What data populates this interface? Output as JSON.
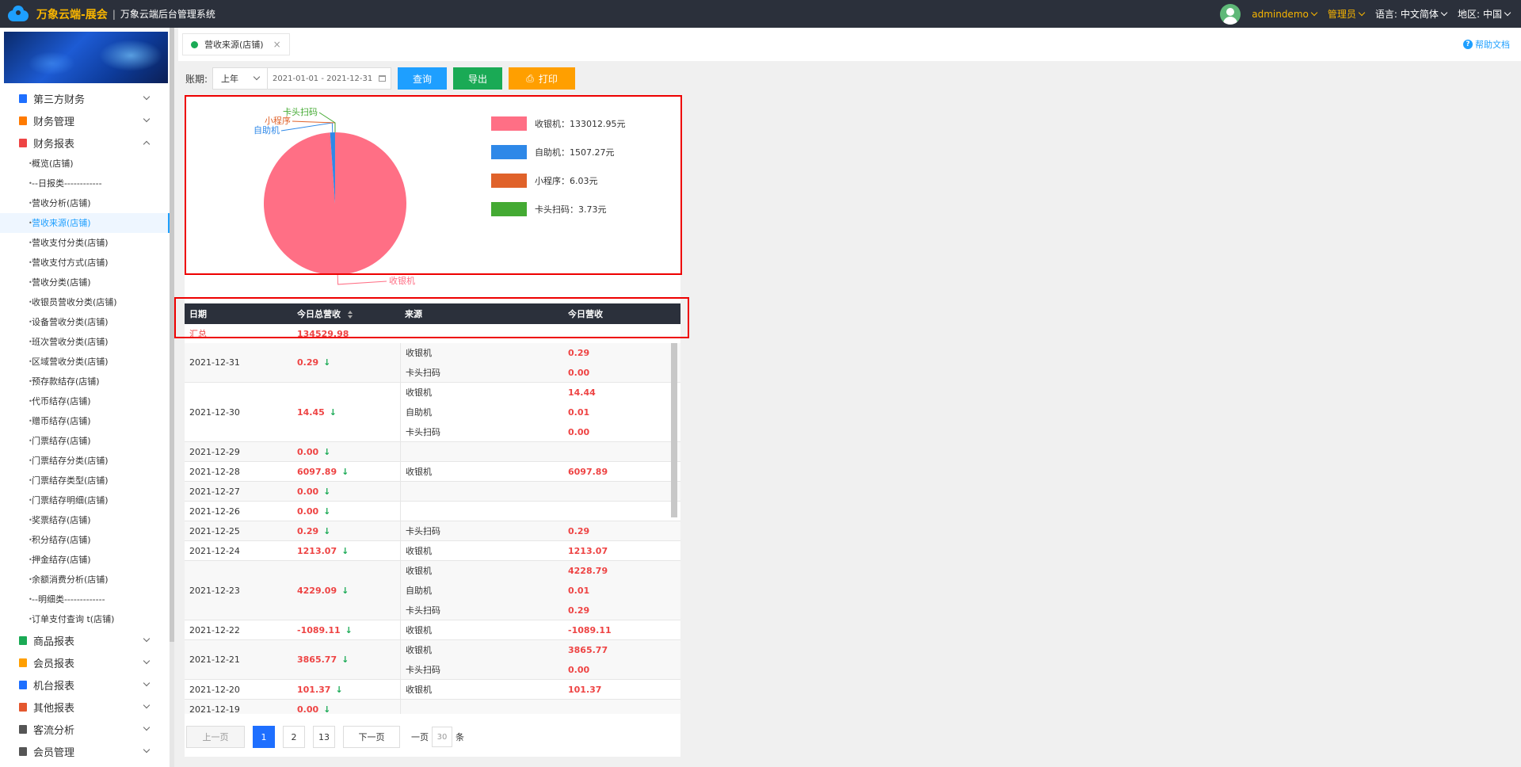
{
  "header": {
    "app_name": "万象云端-展会",
    "separator": "|",
    "system_name": "万象云端后台管理系统",
    "user": "admindemo",
    "role": "管理员",
    "lang_label": "语言:",
    "lang_value": "中文简体",
    "region_label": "地区:",
    "region_value": "中国"
  },
  "sidebar": {
    "groups_top": [
      {
        "label": "第三方财务",
        "color": "#1e6fff"
      },
      {
        "label": "财务管理",
        "color": "#ff7a00"
      },
      {
        "label": "财务报表",
        "color": "#e44"
      }
    ],
    "report_items": [
      "概览(店铺)",
      "--日报类------------",
      "营收分析(店铺)",
      "营收来源(店铺)",
      "营收支付分类(店铺)",
      "营收支付方式(店铺)",
      "营收分类(店铺)",
      "收银员营收分类(店铺)",
      "设备营收分类(店铺)",
      "班次营收分类(店铺)",
      "区域营收分类(店铺)",
      "预存款结存(店铺)",
      "代币结存(店铺)",
      "赠币结存(店铺)",
      "门票结存(店铺)",
      "门票结存分类(店铺)",
      "门票结存类型(店铺)",
      "门票结存明细(店铺)",
      "奖票结存(店铺)",
      "积分结存(店铺)",
      "押金结存(店铺)",
      "余额消费分析(店铺)",
      "--明细类-------------",
      "订单支付查询 t(店铺)"
    ],
    "active_index": 3,
    "groups_bottom": [
      {
        "label": "商品报表",
        "color": "#1aaa55"
      },
      {
        "label": "会员报表",
        "color": "#ff9f00"
      },
      {
        "label": "机台报表",
        "color": "#1e6fff"
      },
      {
        "label": "其他报表",
        "color": "#e4572e"
      },
      {
        "label": "客流分析",
        "color": "#555"
      },
      {
        "label": "会员管理",
        "color": "#555"
      }
    ]
  },
  "tabs": {
    "active_tab": "营收来源(店铺)",
    "close": "×",
    "help": "帮助文档"
  },
  "toolbar": {
    "period_label": "账期:",
    "period_value": "上年",
    "date_range": "2021-01-01 - 2021-12-31",
    "query": "查询",
    "export": "导出",
    "print": "打印"
  },
  "chart_data": {
    "type": "pie",
    "slices": [
      {
        "label": "收银机",
        "value": 133012.95,
        "color": "#ff6f85"
      },
      {
        "label": "自助机",
        "value": 1507.27,
        "color": "#2e88e8"
      },
      {
        "label": "小程序",
        "value": 6.03,
        "color": "#e0622a"
      },
      {
        "label": "卡头扫码",
        "value": 3.73,
        "color": "#44aa33"
      }
    ],
    "legend": [
      "收银机：133012.95元",
      "自助机：1507.27元",
      "小程序：6.03元",
      "卡头扫码：3.73元"
    ],
    "legend_position": "right"
  },
  "table": {
    "headers": [
      "日期",
      "今日总营收",
      "来源",
      "今日营收"
    ],
    "summary_label": "汇总",
    "summary_value": "134529.98",
    "rows": [
      {
        "date": "2021-12-31",
        "total": "0.29",
        "subs": [
          "收银机",
          "卡头扫码"
        ],
        "vals": [
          "0.29",
          "0.00"
        ]
      },
      {
        "date": "2021-12-30",
        "total": "14.45",
        "subs": [
          "收银机",
          "自助机",
          "卡头扫码"
        ],
        "vals": [
          "14.44",
          "0.01",
          "0.00"
        ]
      },
      {
        "date": "2021-12-29",
        "total": "0.00",
        "subs": [],
        "vals": []
      },
      {
        "date": "2021-12-28",
        "total": "6097.89",
        "subs": [
          "收银机"
        ],
        "vals": [
          "6097.89"
        ]
      },
      {
        "date": "2021-12-27",
        "total": "0.00",
        "subs": [],
        "vals": []
      },
      {
        "date": "2021-12-26",
        "total": "0.00",
        "subs": [],
        "vals": []
      },
      {
        "date": "2021-12-25",
        "total": "0.29",
        "subs": [
          "卡头扫码"
        ],
        "vals": [
          "0.29"
        ]
      },
      {
        "date": "2021-12-24",
        "total": "1213.07",
        "subs": [
          "收银机"
        ],
        "vals": [
          "1213.07"
        ]
      },
      {
        "date": "2021-12-23",
        "total": "4229.09",
        "subs": [
          "收银机",
          "自助机",
          "卡头扫码"
        ],
        "vals": [
          "4228.79",
          "0.01",
          "0.29"
        ]
      },
      {
        "date": "2021-12-22",
        "total": "-1089.11",
        "subs": [
          "收银机"
        ],
        "vals": [
          "-1089.11"
        ]
      },
      {
        "date": "2021-12-21",
        "total": "3865.77",
        "subs": [
          "收银机",
          "卡头扫码"
        ],
        "vals": [
          "3865.77",
          "0.00"
        ]
      },
      {
        "date": "2021-12-20",
        "total": "101.37",
        "subs": [
          "收银机"
        ],
        "vals": [
          "101.37"
        ]
      },
      {
        "date": "2021-12-19",
        "total": "0.00",
        "subs": [],
        "vals": []
      }
    ],
    "down_arrow": "↓"
  },
  "pager": {
    "prev": "上一页",
    "pages": [
      "1",
      "2",
      "13"
    ],
    "active_page": "1",
    "next": "下一页",
    "per_page_label": "一页",
    "per_page_value": "30",
    "unit": "条"
  }
}
